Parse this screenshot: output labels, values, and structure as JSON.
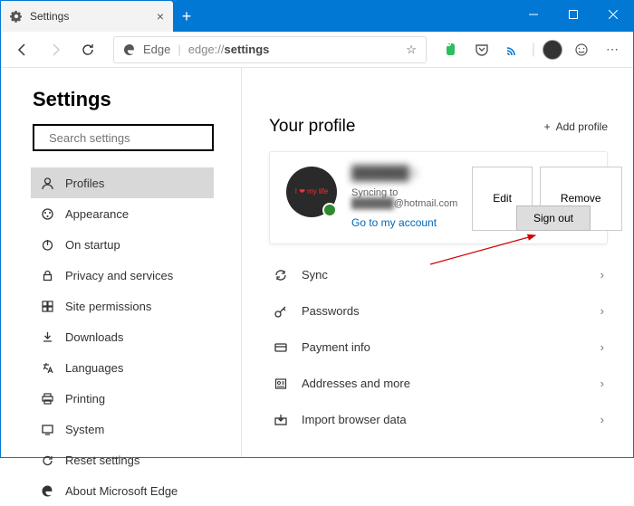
{
  "titlebar": {
    "tab_title": "Settings"
  },
  "toolbar": {
    "edge_label": "Edge",
    "url_prefix": "edge://",
    "url_page": "settings"
  },
  "sidebar": {
    "heading": "Settings",
    "search_placeholder": "Search settings",
    "items": [
      {
        "label": "Profiles",
        "icon": "user-icon",
        "active": true
      },
      {
        "label": "Appearance",
        "icon": "appearance-icon"
      },
      {
        "label": "On startup",
        "icon": "power-icon"
      },
      {
        "label": "Privacy and services",
        "icon": "lock-icon"
      },
      {
        "label": "Site permissions",
        "icon": "site-icon"
      },
      {
        "label": "Downloads",
        "icon": "download-icon"
      },
      {
        "label": "Languages",
        "icon": "language-icon"
      },
      {
        "label": "Printing",
        "icon": "printer-icon"
      },
      {
        "label": "System",
        "icon": "system-icon"
      },
      {
        "label": "Reset settings",
        "icon": "reset-icon"
      },
      {
        "label": "About Microsoft Edge",
        "icon": "edge-icon"
      }
    ]
  },
  "profile": {
    "heading": "Your profile",
    "add_profile": "Add profile",
    "name": "██████ t",
    "sync_label": "Syncing to",
    "email_suffix": "@hotmail.com",
    "account_link": "Go to my account",
    "edit": "Edit",
    "remove": "Remove",
    "signout": "Sign out",
    "avatar_text": "I ❤ my life"
  },
  "rows": [
    {
      "label": "Sync",
      "icon": "sync-icon"
    },
    {
      "label": "Passwords",
      "icon": "key-icon"
    },
    {
      "label": "Payment info",
      "icon": "payment-icon"
    },
    {
      "label": "Addresses and more",
      "icon": "address-icon"
    },
    {
      "label": "Import browser data",
      "icon": "import-icon"
    }
  ]
}
